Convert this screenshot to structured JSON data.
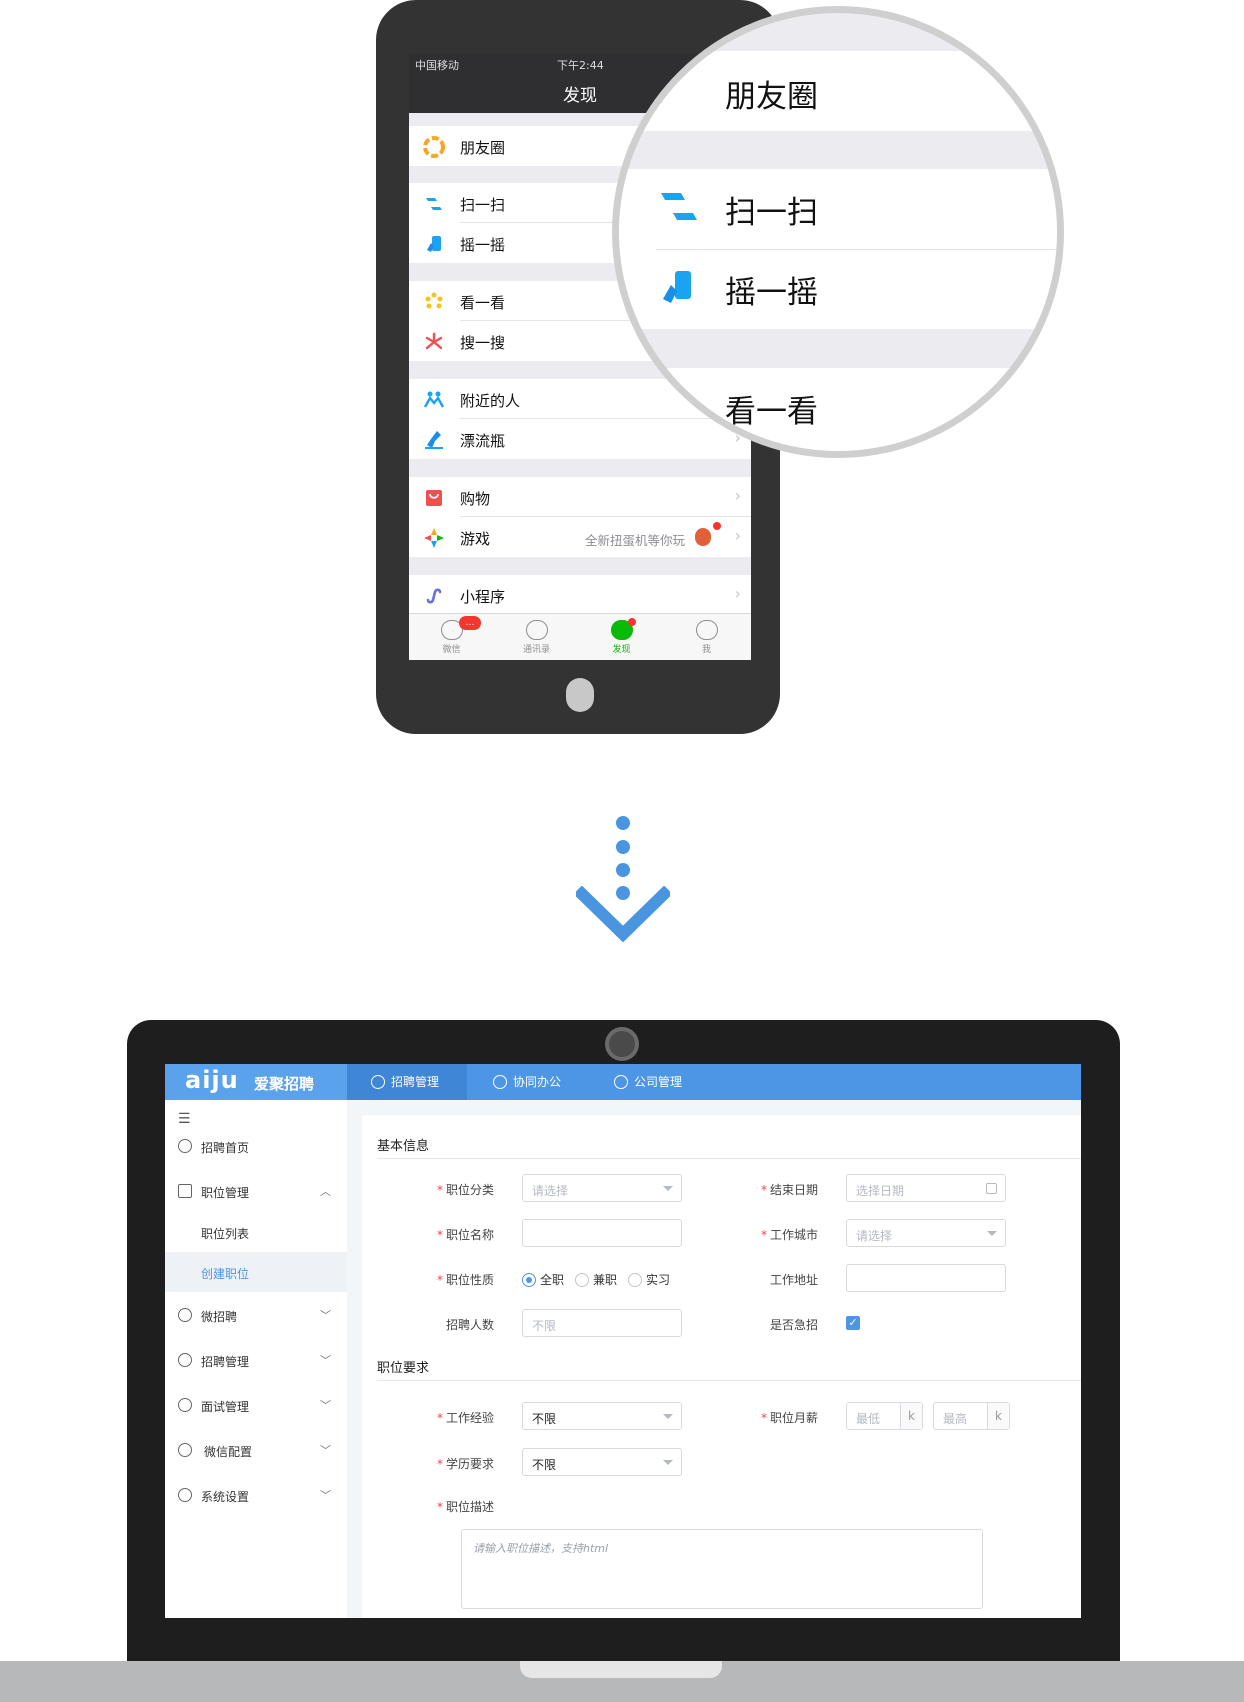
{
  "phone": {
    "status": {
      "carrier": "中国移动",
      "time": "下午2:44"
    },
    "title": "发现",
    "rows": [
      {
        "label": "朋友圈",
        "icon": "moments-icon",
        "color": "#f5a623"
      },
      {
        "label": "扫一扫",
        "icon": "scan-icon",
        "color": "#1aa3f0"
      },
      {
        "label": "摇一摇",
        "icon": "shake-icon",
        "color": "#1aa3f0"
      },
      {
        "label": "看一看",
        "icon": "top-stories-icon",
        "color": "#f8c21c"
      },
      {
        "label": "搜一搜",
        "icon": "search-icon",
        "color": "#f04f4f"
      },
      {
        "label": "附近的人",
        "icon": "people-nearby-icon",
        "color": "#1aa3f0"
      },
      {
        "label": "漂流瓶",
        "icon": "drift-bottle-icon",
        "color": "#1a8fe8"
      },
      {
        "label": "购物",
        "icon": "shopping-icon",
        "color": "#f04f4f"
      },
      {
        "label": "游戏",
        "icon": "games-icon",
        "color": "#f5a623",
        "promo": "全新扭蛋机等你玩"
      },
      {
        "label": "小程序",
        "icon": "mini-program-icon",
        "color": "#6b6fd8"
      }
    ],
    "tabs": [
      {
        "label": "微信",
        "badge": "…"
      },
      {
        "label": "通讯录"
      },
      {
        "label": "发现"
      },
      {
        "label": "我"
      }
    ],
    "magnifier": [
      "朋友圈",
      "扫一扫",
      "摇一摇",
      "看一看"
    ]
  },
  "app": {
    "logo_mark": "aiju",
    "logo_name": "爱聚招聘",
    "top_nav": [
      "招聘管理",
      "协同办公",
      "公司管理"
    ],
    "sidebar": {
      "toggle": "☰",
      "items": [
        "招聘首页",
        "职位管理",
        "微招聘",
        "招聘管理",
        "面试管理",
        "微信配置",
        "系统设置"
      ],
      "sub_items": [
        "职位列表",
        "创建职位"
      ]
    },
    "form": {
      "basic_title": "基本信息",
      "req_title": "职位要求",
      "category_label": "职位分类",
      "category_placeholder": "请选择",
      "end_date_label": "结束日期",
      "end_date_placeholder": "选择日期",
      "job_name_label": "职位名称",
      "city_label": "工作城市",
      "city_placeholder": "请选择",
      "nature_label": "职位性质",
      "nature_options": [
        "全职",
        "兼职",
        "实习"
      ],
      "nature_selected": "全职",
      "address_label": "工作地址",
      "headcount_label": "招聘人数",
      "headcount_placeholder": "不限",
      "urgent_label": "是否急招",
      "urgent_checked": true,
      "experience_label": "工作经验",
      "experience_value": "不限",
      "salary_label": "职位月薪",
      "salary_min_placeholder": "最低",
      "salary_max_placeholder": "最高",
      "salary_unit": "k",
      "education_label": "学历要求",
      "education_value": "不限",
      "description_label": "职位描述",
      "description_placeholder": "请输入职位描述，支持html"
    }
  }
}
